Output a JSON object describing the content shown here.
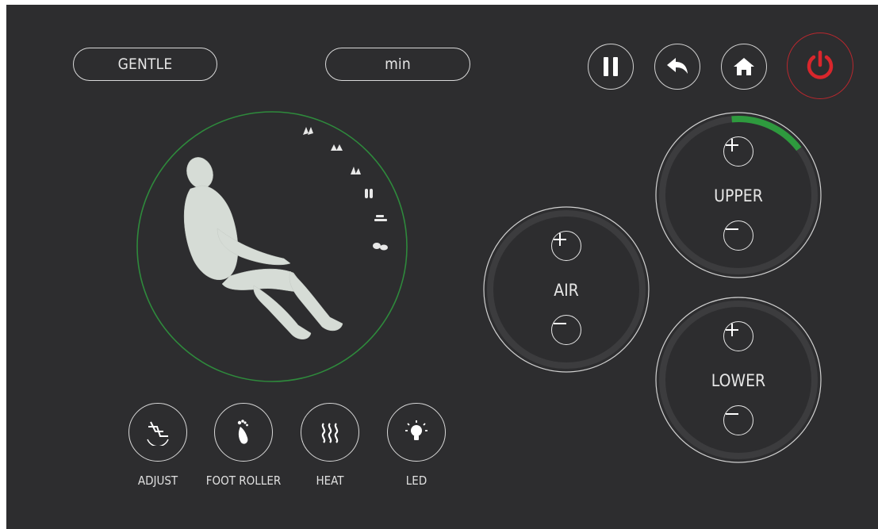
{
  "header": {
    "mode_label": "GENTLE",
    "time_label": "min"
  },
  "toolbar": {
    "pause_icon": "pause-icon",
    "back_icon": "back-arrow-icon",
    "home_icon": "home-icon",
    "power_icon": "power-icon",
    "power_color": "#d9262c"
  },
  "airbag": {
    "upper": {
      "label": "UPPER",
      "intensity_fraction": 0.16,
      "accent": "#2e9a3e"
    },
    "air": {
      "label": "AIR",
      "intensity_fraction": 0
    },
    "lower": {
      "label": "LOWER",
      "intensity_fraction": 0
    }
  },
  "functions": [
    {
      "label": "ADJUST",
      "icon": "adjust-icon"
    },
    {
      "label": "FOOT ROLLER",
      "icon": "foot-icon"
    },
    {
      "label": "HEAT",
      "icon": "heat-icon"
    },
    {
      "label": "LED",
      "icon": "bulb-icon"
    }
  ],
  "body_figure": {
    "ring_color": "#2e8a3c",
    "icons": [
      "hands-icon",
      "hands-icon",
      "hands-icon",
      "hands-icon",
      "roller-icon",
      "feet-icon"
    ]
  }
}
